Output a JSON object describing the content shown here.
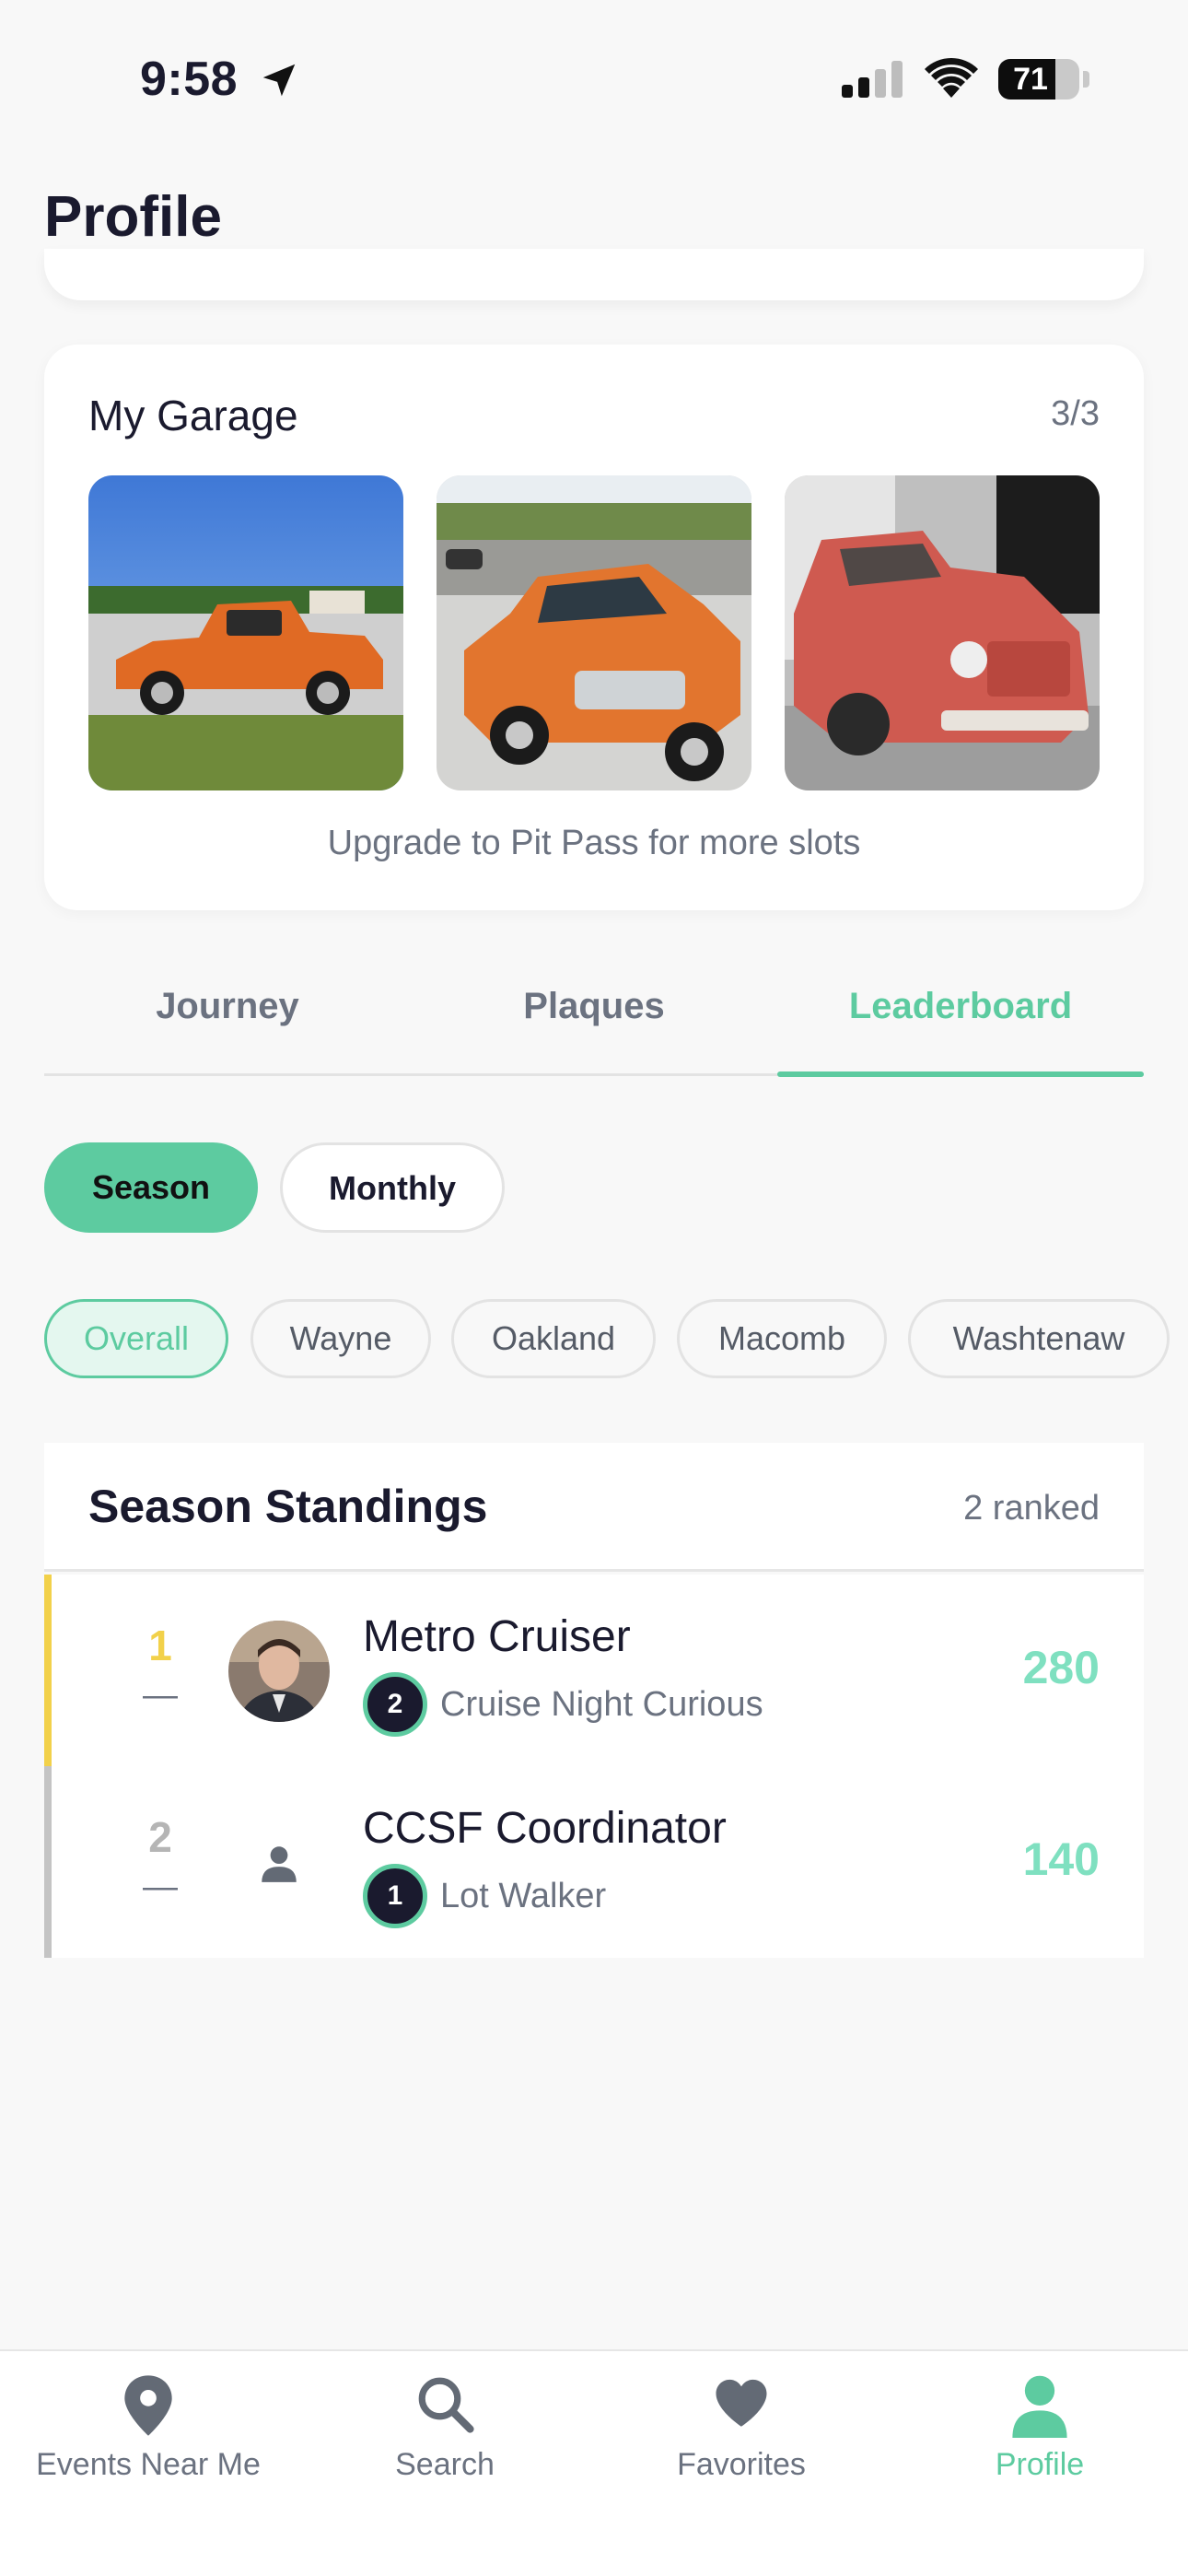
{
  "status_bar": {
    "time": "9:58",
    "battery": "71"
  },
  "header": {
    "title": "Profile"
  },
  "garage": {
    "title": "My Garage",
    "count": "3/3",
    "upgrade_text": "Upgrade to Pit Pass for more slots"
  },
  "tabs": [
    {
      "label": "Journey",
      "active": false
    },
    {
      "label": "Plaques",
      "active": false
    },
    {
      "label": "Leaderboard",
      "active": true
    }
  ],
  "period_toggle": {
    "season": "Season",
    "monthly": "Monthly",
    "selected": "Season"
  },
  "regions": [
    "Overall",
    "Wayne",
    "Oakland",
    "Macomb",
    "Washtenaw"
  ],
  "standings": {
    "title": "Season Standings",
    "count": "2 ranked",
    "rows": [
      {
        "rank": "1",
        "change": "—",
        "name": "Metro Cruiser",
        "level": "2",
        "level_title": "Cruise Night Curious",
        "points": "280"
      },
      {
        "rank": "2",
        "change": "—",
        "name": "CCSF Coordinator",
        "level": "1",
        "level_title": "Lot Walker",
        "points": "140"
      }
    ]
  },
  "bottom_nav": [
    {
      "label": "Events Near Me",
      "icon": "map-pin-icon"
    },
    {
      "label": "Search",
      "icon": "search-icon"
    },
    {
      "label": "Favorites",
      "icon": "heart-icon"
    },
    {
      "label": "Profile",
      "icon": "user-icon",
      "active": true
    }
  ],
  "colors": {
    "accent": "#5dcba0",
    "gold": "#f2d14a",
    "silver": "#c4c4c4",
    "text": "#1a1a2e"
  }
}
